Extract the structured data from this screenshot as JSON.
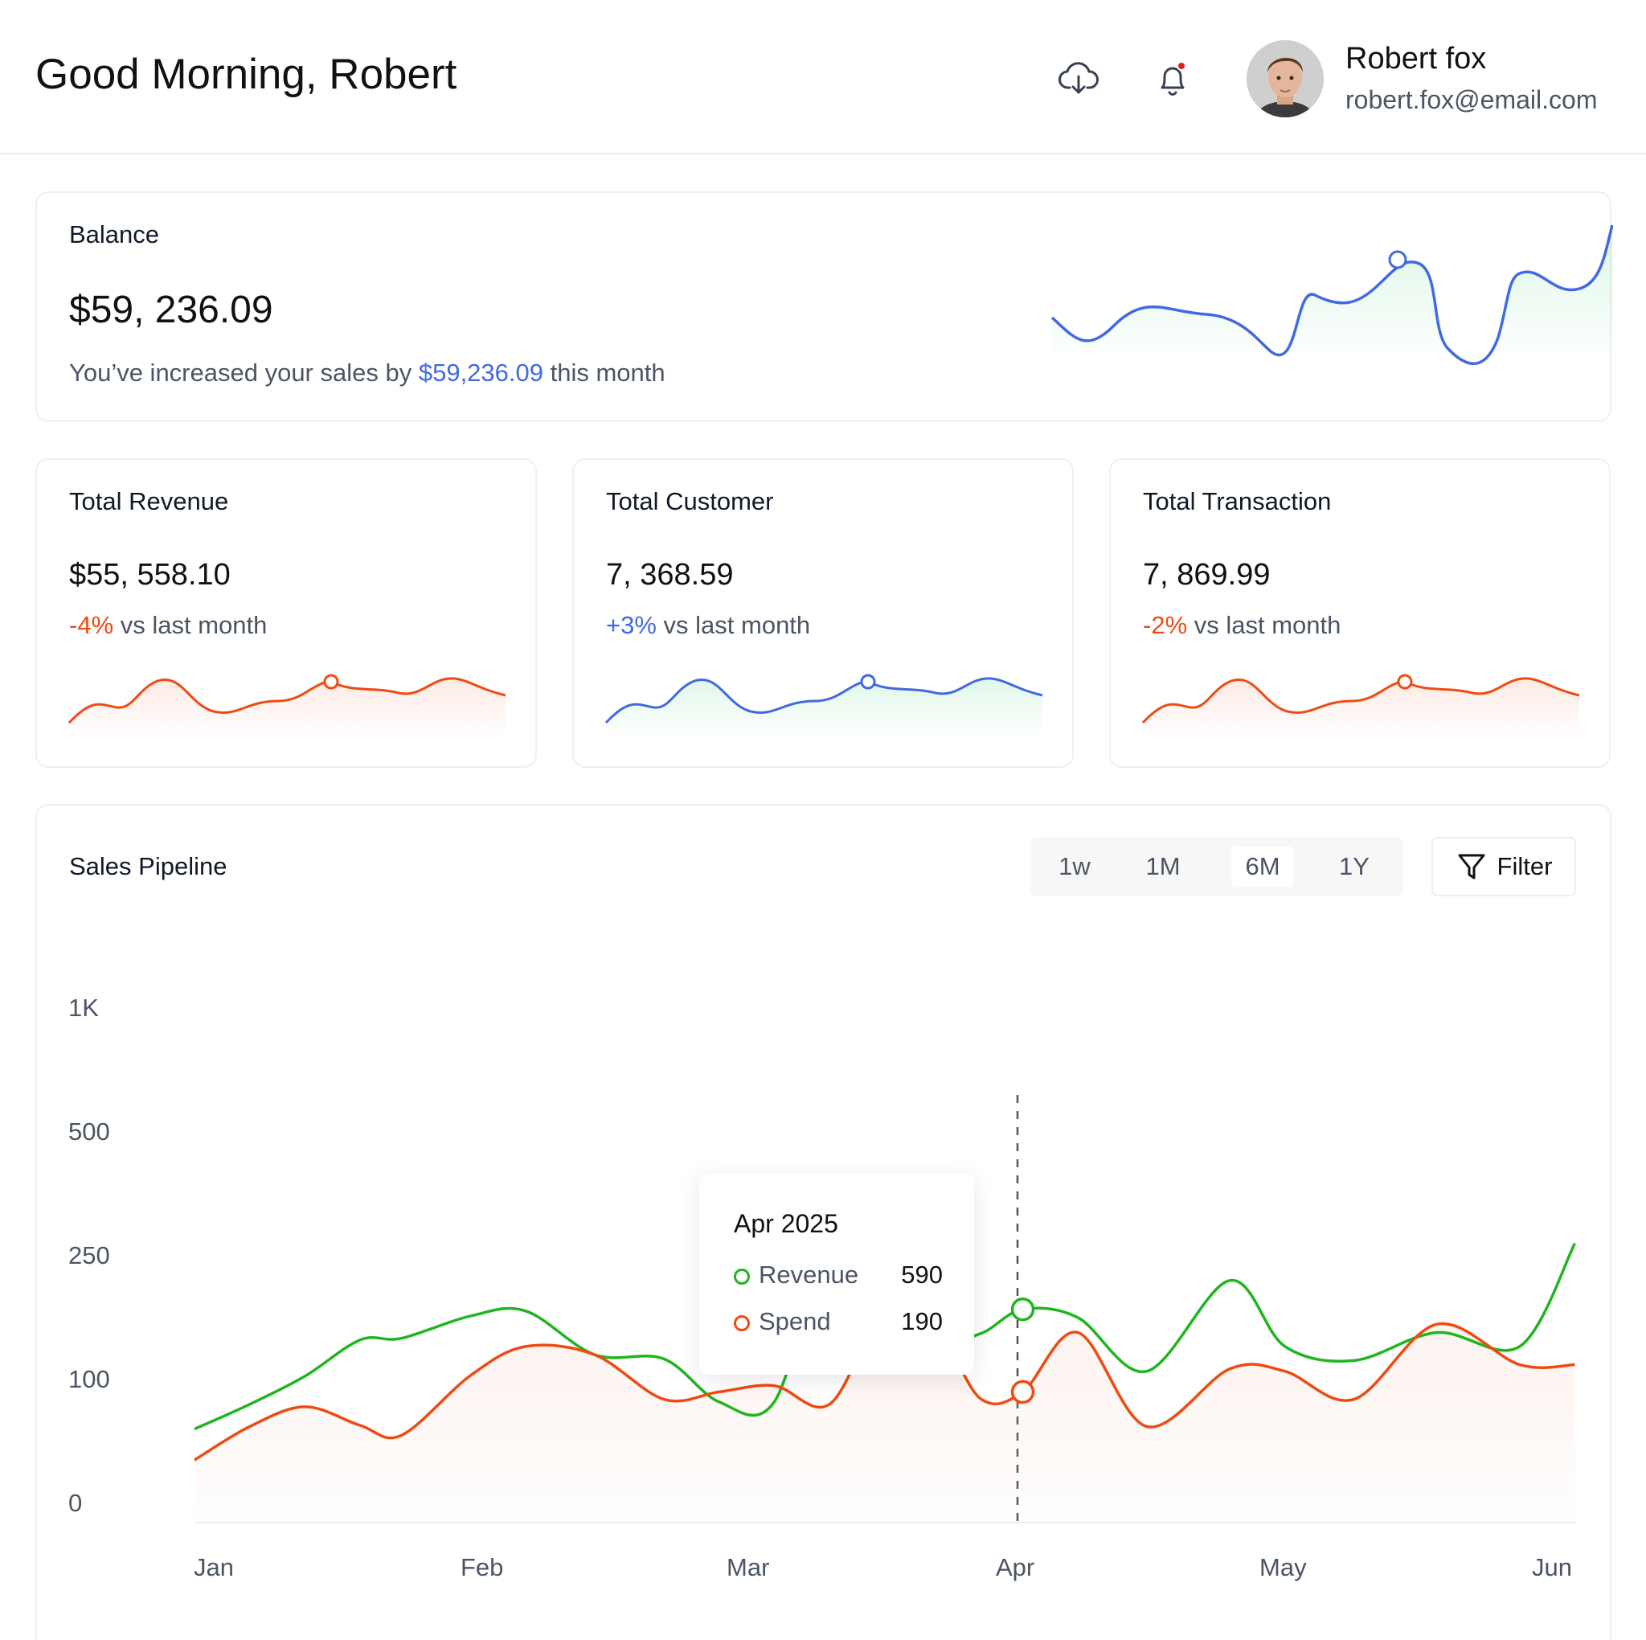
{
  "header": {
    "greeting": "Good Morning, Robert",
    "user": {
      "name": "Robert fox",
      "email": "robert.fox@email.com"
    },
    "icons": [
      "cloud-download-icon",
      "bell-icon"
    ],
    "notification_dot_color": "#e11d1d"
  },
  "balance": {
    "title": "Balance",
    "value": "$59, 236.09",
    "note_prefix": "You’ve increased your sales by ",
    "note_amount": "$59,236.09",
    "note_suffix": " this month"
  },
  "stats": [
    {
      "title": "Total Revenue",
      "value": "$55, 558.10",
      "change": "-4%",
      "suffix": " vs last month",
      "trend": "negative"
    },
    {
      "title": "Total Customer",
      "value": "7, 368.59",
      "change": "+3%",
      "suffix": " vs last month",
      "trend": "positive"
    },
    {
      "title": "Total Transaction",
      "value": "7, 869.99",
      "change": "-2%",
      "suffix": " vs last month",
      "trend": "negative"
    }
  ],
  "pipeline": {
    "title": "Sales Pipeline",
    "periods": [
      "1w",
      "1M",
      "6M",
      "1Y"
    ],
    "active_period": "6M",
    "filter_label": "Filter",
    "tooltip": {
      "title": "Apr 2025",
      "rows": [
        {
          "label": "Revenue",
          "value": "590",
          "color": "#1fb51f"
        },
        {
          "label": "Spend",
          "value": "190",
          "color": "#ef4a12"
        }
      ]
    }
  },
  "colors": {
    "revenue": "#1fb51f",
    "spend": "#ef4a12",
    "accent_blue": "#4169e1",
    "negative": "#ef4a12"
  },
  "chart_data": {
    "type": "line",
    "title": "Sales Pipeline",
    "categories": [
      "Jan",
      "Feb",
      "Mar",
      "Apr",
      "May",
      "Jun"
    ],
    "y_ticks": [
      "0",
      "100",
      "250",
      "500",
      "1K"
    ],
    "y_tick_values": [
      0,
      100,
      250,
      500,
      1000
    ],
    "x": [
      0,
      0.2,
      0.4,
      0.6,
      0.75,
      1.0,
      1.2,
      1.45,
      1.7,
      1.9,
      2.1,
      2.3,
      2.5,
      2.7,
      2.85,
      3.0,
      3.2,
      3.45,
      3.75,
      3.95,
      4.2,
      4.5,
      4.8,
      5.0
    ],
    "series": [
      {
        "name": "Revenue",
        "color": "#1fb51f",
        "values": [
          60,
          80,
          104,
          148,
          150,
          177,
          183,
          130,
          125,
          82,
          82,
          275,
          215,
          150,
          156,
          185,
          175,
          110,
          220,
          140,
          123,
          157,
          140,
          275
        ]
      },
      {
        "name": "Spend",
        "color": "#ef4a12",
        "values": [
          35,
          62,
          78,
          63,
          55,
          105,
          140,
          130,
          84,
          90,
          95,
          80,
          180,
          152,
          84,
          90,
          157,
          62,
          113,
          110,
          84,
          167,
          118,
          118
        ]
      }
    ],
    "highlight": {
      "x": "Apr",
      "Revenue": 590,
      "Spend": 190
    }
  }
}
